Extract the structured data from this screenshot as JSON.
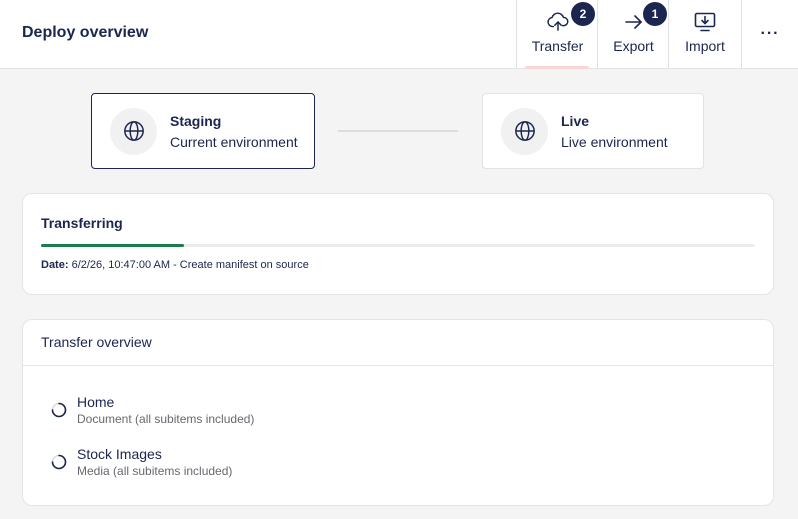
{
  "header": {
    "title": "Deploy overview",
    "tabs": [
      {
        "label": "Transfer",
        "icon": "cloud-upload-icon",
        "badge": "2"
      },
      {
        "label": "Export",
        "icon": "arrow-right-icon",
        "badge": "1"
      },
      {
        "label": "Import",
        "icon": "monitor-download-icon"
      }
    ],
    "more_label": "···"
  },
  "environments": {
    "source": {
      "name": "Staging",
      "description": "Current environment",
      "icon": "globe-icon"
    },
    "target": {
      "name": "Live",
      "description": "Live environment",
      "icon": "globe-icon"
    }
  },
  "progress": {
    "title": "Transferring",
    "percent": 20,
    "date_label": "Date:",
    "status_text": " 6/2/26, 10:47:00 AM - Create manifest on source",
    "color": "#1e7b4d"
  },
  "overview": {
    "title": "Transfer overview",
    "items": [
      {
        "name": "Home",
        "description": "Document (all subitems included)"
      },
      {
        "name": "Stock Images",
        "description": "Media (all subitems included)"
      }
    ]
  },
  "colors": {
    "accent": "#1b264f",
    "background": "#f4f4f4"
  }
}
